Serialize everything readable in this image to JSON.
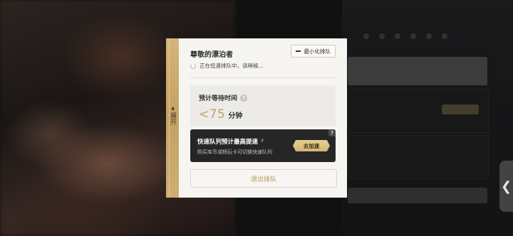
{
  "dialog": {
    "expand_label": "展开",
    "title": "尊敬的漂泊者",
    "minimize_label": "最小化排队",
    "status_text": "正在低速排队中，请稍候...",
    "wait": {
      "title": "预计等待时间",
      "help_symbol": "?",
      "value": "<75",
      "unit": "分钟"
    },
    "boost": {
      "title": "快速队列预计最高提速",
      "subtitle": "购买库币或畅玩卡可切换快速队列",
      "help_symbol": "?",
      "button_label": "去加速"
    },
    "exit_label": "退出排队"
  },
  "side_handle": {
    "symbol": "❮"
  },
  "colors": {
    "accent_gold": "#c2a266",
    "strip_gold": "#d6b579",
    "card_bg": "#f6f5f2",
    "boost_bg": "#262626"
  },
  "icons": [
    "chevron-left-icon",
    "spinner-icon",
    "minimize-icon",
    "help-icon",
    "bolt-icon"
  ]
}
